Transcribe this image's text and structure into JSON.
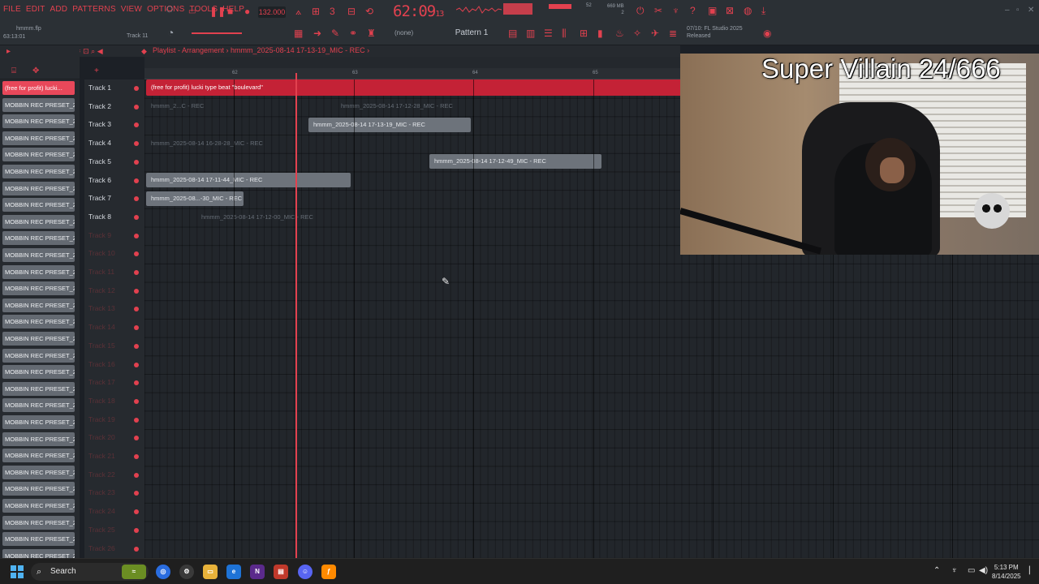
{
  "menu": [
    "FILE",
    "EDIT",
    "ADD",
    "PATTERNS",
    "VIEW",
    "OPTIONS",
    "TOOLS",
    "HELP"
  ],
  "project": {
    "file_name": "hmmm.flp",
    "time": "63:13:01",
    "hint_track": "Track 11"
  },
  "transport": {
    "tempo": "132.000",
    "song_position": "62:09",
    "song_position_ticks": "13",
    "pattern": "Pattern 1",
    "none_label": "(none)"
  },
  "stats": {
    "memory": "669 MB",
    "mem_sub": "2",
    "cpu": "52"
  },
  "news": {
    "line1": "07/10: FL Studio 2025",
    "line2": "Released"
  },
  "playlist": {
    "title": "Playlist - Arrangement",
    "clip_source": "hmmm_2025-08-14 17-13-19_MIC - REC",
    "ruler": [
      "62",
      "63",
      "64",
      "65"
    ]
  },
  "channels": [
    "(free for profit) lucki...",
    "MOBBIN REC PRESET_202...",
    "MOBBIN REC PRESET_202...",
    "MOBBIN REC PRESET_202...",
    "MOBBIN REC PRESET_202...",
    "MOBBIN REC PRESET_202...",
    "MOBBIN REC PRESET_202...",
    "MOBBIN REC PRESET_202...",
    "MOBBIN REC PRESET_202...",
    "MOBBIN REC PRESET_202...",
    "MOBBIN REC PRESET_202...",
    "MOBBIN REC PRESET_202...",
    "MOBBIN REC PRESET_202...",
    "MOBBIN REC PRESET_202...",
    "MOBBIN REC PRESET_202...",
    "MOBBIN REC PRESET_202...",
    "MOBBIN REC PRESET_202...",
    "MOBBIN REC PRESET_202...",
    "MOBBIN REC PRESET_202...",
    "MOBBIN REC PRESET_202...",
    "MOBBIN REC PRESET_202...",
    "MOBBIN REC PRESET_202...",
    "MOBBIN REC PRESET_202...",
    "MOBBIN REC PRESET_202...",
    "MOBBIN REC PRESET_202...",
    "MOBBIN REC PRESET_202...",
    "MOBBIN REC PRESET_202...",
    "MOBBIN REC PRESET_202...",
    "MOBBIN REC PRESET_202...",
    "MOBBIN REC PRESET_202...",
    "MOBBIN REC PRESET_202..."
  ],
  "tracks": [
    "Track 1",
    "Track 2",
    "Track 3",
    "Track 4",
    "Track 5",
    "Track 6",
    "Track 7",
    "Track 8",
    "Track 9",
    "Track 10",
    "Track 11",
    "Track 12",
    "Track 13",
    "Track 14",
    "Track 15",
    "Track 16",
    "Track 17",
    "Track 18",
    "Track 19",
    "Track 20",
    "Track 21",
    "Track 22",
    "Track 23",
    "Track 24",
    "Track 25",
    "Track 26"
  ],
  "clips": {
    "beat": "(free for profit) lucki type beat \"boulevard\"",
    "t2a": "hmmm_2...C - REC",
    "t2b": "hmmm_2025-08-14 17-12-28_MIC - REC",
    "t3": "hmmm_2025-08-14 17-13-19_MIC - REC",
    "t4": "hmmm_2025-08-14 16-28-28_MIC - REC",
    "t5": "hmmm_2025-08-14 17-12-49_MIC - REC",
    "t6": "hmmm_2025-08-14 17-11-44_MIC - REC",
    "t7": "hmmm_2025-08...-30_MIC - REC",
    "t8": "hmmm_2025-08-14 17-12-00_MIC - REC"
  },
  "webcam": {
    "overlay": "Super Villain 24/666"
  },
  "taskbar": {
    "search": "Search",
    "time": "5:13 PM",
    "date": "8/14/2025"
  },
  "colors": {
    "accent": "#e2414f",
    "channel_bg": "#646a72",
    "clip_audio": "#6d737b",
    "beat_clip": "#c42236"
  }
}
